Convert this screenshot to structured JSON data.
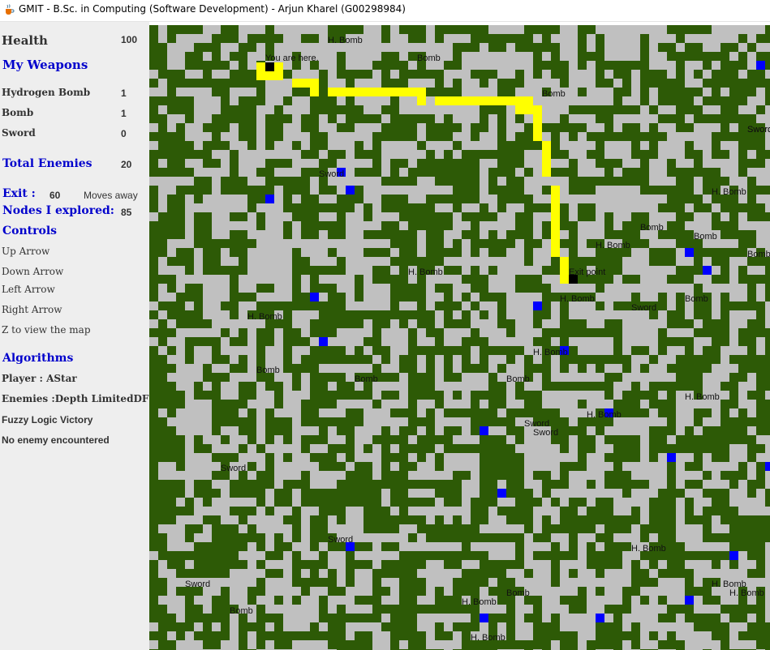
{
  "window": {
    "title": "GMIT - B.Sc. in Computing (Software Development) - Arjun Kharel (G00298984)",
    "icon": "java-cup-icon"
  },
  "sidebar": {
    "health_label": "Health",
    "health_value": "100",
    "weapons_heading": "My Weapons",
    "weapons": [
      {
        "name": "Hydrogen Bomb",
        "count": "1"
      },
      {
        "name": "Bomb",
        "count": "1"
      },
      {
        "name": "Sword",
        "count": "0"
      }
    ],
    "total_enemies_label": "Total Enemies",
    "total_enemies_value": "20",
    "exit_label": "Exit :",
    "exit_value": "60",
    "exit_suffix": "Moves away",
    "nodes_label": "Nodes I explored:",
    "nodes_value": "85",
    "controls_heading": "Controls",
    "controls": [
      "Up Arrow",
      "Down Arrow",
      "Left Arrow",
      "Right Arrow",
      "Z to view the map"
    ],
    "algorithms_heading": "Algorithms",
    "player_algo": "Player : AStar",
    "enemy_algo": "Enemies :Depth LimitedDFS",
    "fuzzy_result": "Fuzzy Logic Victory",
    "encounter_status": "No enemy encountered"
  },
  "map": {
    "colors": {
      "floor": "#c0c0c0",
      "wall": "#2d5a06",
      "path": "#ffff00",
      "enemy": "#0000ff",
      "marker": "#000000"
    },
    "labels": [
      {
        "text": "You are here.",
        "kind": "player"
      },
      {
        "text": "Exit point",
        "kind": "exit"
      },
      {
        "text": "H. Bomb",
        "kind": "item"
      },
      {
        "text": "Bomb",
        "kind": "item"
      },
      {
        "text": "Bomb",
        "kind": "item"
      },
      {
        "text": "Sword",
        "kind": "item"
      },
      {
        "text": "Sword",
        "kind": "item"
      },
      {
        "text": "H. Bomb",
        "kind": "item"
      },
      {
        "text": "Bomb",
        "kind": "item"
      },
      {
        "text": "H. Bomb",
        "kind": "item"
      },
      {
        "text": "Bomb",
        "kind": "item"
      },
      {
        "text": "Bomb",
        "kind": "item"
      },
      {
        "text": "H. Bomb",
        "kind": "item"
      },
      {
        "text": "H. Bomb",
        "kind": "item"
      },
      {
        "text": "Sword",
        "kind": "item"
      },
      {
        "text": "Bomb",
        "kind": "item"
      },
      {
        "text": "H. Bomb",
        "kind": "item"
      },
      {
        "text": "H. Bomb",
        "kind": "item"
      },
      {
        "text": "Bomb",
        "kind": "item"
      },
      {
        "text": "Bomb",
        "kind": "item"
      },
      {
        "text": "Bomb",
        "kind": "item"
      },
      {
        "text": "H. Bomb",
        "kind": "item"
      },
      {
        "text": "H. Bomb",
        "kind": "item"
      },
      {
        "text": "Sword",
        "kind": "item"
      },
      {
        "text": "Sword",
        "kind": "item"
      },
      {
        "text": "Sword",
        "kind": "item"
      },
      {
        "text": "H. Bomb",
        "kind": "item"
      },
      {
        "text": "Sword",
        "kind": "item"
      },
      {
        "text": "Sword",
        "kind": "item"
      },
      {
        "text": "Bomb",
        "kind": "item"
      },
      {
        "text": "H. Bomb",
        "kind": "item"
      },
      {
        "text": "Bomb",
        "kind": "item"
      },
      {
        "text": "H. Bomb",
        "kind": "item"
      },
      {
        "text": "H. Bomb",
        "kind": "item"
      },
      {
        "text": "H. Bomb",
        "kind": "item"
      },
      {
        "text": "Sword",
        "kind": "item"
      }
    ]
  }
}
